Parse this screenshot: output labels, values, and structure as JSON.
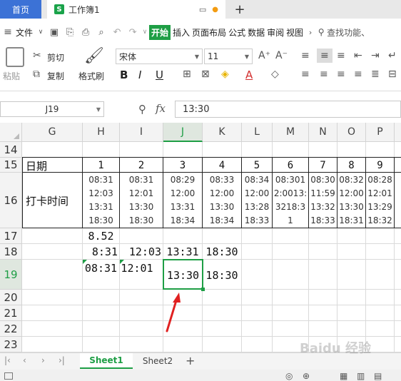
{
  "tabs": {
    "home": "首页",
    "doc": "工作簿1"
  },
  "menu": {
    "file": "文件",
    "items": [
      "开始",
      "插入",
      "页面布局",
      "公式",
      "数据",
      "审阅",
      "视图"
    ],
    "search": "查找功能、"
  },
  "toolbar": {
    "paste": "粘贴",
    "cut": "剪切",
    "copy": "复制",
    "format_painter": "格式刷",
    "font_name": "宋体",
    "font_size": "11"
  },
  "formula_bar": {
    "name_box": "J19",
    "fx": "fx",
    "value": "13:30"
  },
  "columns": [
    "G",
    "H",
    "I",
    "J",
    "K",
    "L",
    "M",
    "N",
    "O",
    "P"
  ],
  "rows": [
    "14",
    "15",
    "16",
    "17",
    "18",
    "19",
    "20",
    "21",
    "22",
    "23"
  ],
  "cells": {
    "g15": "日期",
    "g16": "打卡时间",
    "day_nums": [
      "1",
      "2",
      "3",
      "4",
      "5",
      "6",
      "7",
      "8",
      "9"
    ],
    "punch_times": [
      "08:31\n12:03\n13:31\n18:30",
      "08:31\n12:01\n13:30\n18:30",
      "08:29\n12:00\n13:31\n18:34",
      "08:33\n12:00\n13:30\n18:34",
      "08:34\n12:00\n13:28\n18:33",
      "08:301\n2:0013:\n3218:3\n1",
      "08:30\n11:59\n13:32\n18:33",
      "08:32\n12:00\n13:30\n18:31",
      "08:28\n12:01\n13:29\n18:32"
    ],
    "h17": "8.52",
    "row18": [
      "8:31",
      "12:03",
      "13:31",
      "18:30"
    ],
    "row19": [
      "08:31",
      "12:01",
      "13:30",
      "18:30"
    ]
  },
  "sheets": [
    "Sheet1",
    "Sheet2"
  ],
  "watermark": "Baidu 经验",
  "colors": {
    "accent": "#1e9e45",
    "home_tab": "#3c72d6",
    "selection": "#1e9e45",
    "arrow": "#e02020"
  }
}
